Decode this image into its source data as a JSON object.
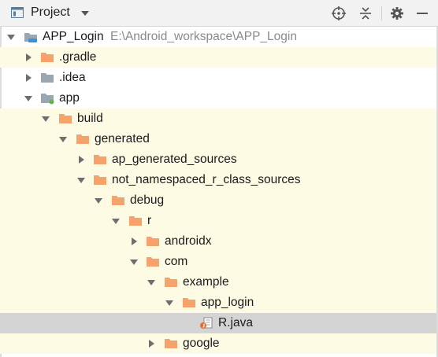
{
  "header": {
    "title": "Project",
    "view_icon": "project-view-icon",
    "dropdown_icon": "chevron-down-icon",
    "buttons": [
      "locate-icon",
      "collapse-all-icon",
      "gear-icon",
      "hide-panel-icon"
    ]
  },
  "colors": {
    "folder": "#f5a26b",
    "folder_grey": "#9aa7b0",
    "highlight_row": "#fdfbe4",
    "selected_row": "#d4d4d4"
  },
  "tree": {
    "root": {
      "label": "APP_Login",
      "path": "E:\\Android_workspace\\APP_Login"
    },
    "gradle": {
      "label": ".gradle"
    },
    "idea": {
      "label": ".idea"
    },
    "app": {
      "label": "app"
    },
    "build": {
      "label": "build"
    },
    "generated": {
      "label": "generated"
    },
    "ap_generated_sources": {
      "label": "ap_generated_sources"
    },
    "not_namespaced": {
      "label": "not_namespaced_r_class_sources"
    },
    "debug": {
      "label": "debug"
    },
    "r": {
      "label": "r"
    },
    "androidx": {
      "label": "androidx"
    },
    "com": {
      "label": "com"
    },
    "example": {
      "label": "example"
    },
    "app_login": {
      "label": "app_login"
    },
    "r_java": {
      "label": "R.java"
    },
    "google": {
      "label": "google"
    }
  }
}
